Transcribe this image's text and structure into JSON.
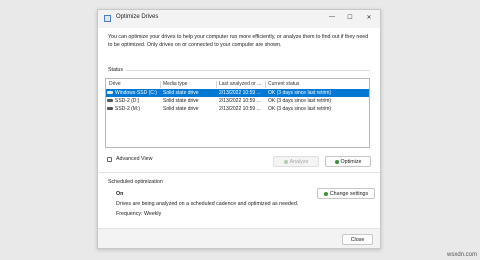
{
  "window": {
    "title": "Optimize Drives",
    "minimize_glyph": "—",
    "maximize_glyph": "☐",
    "close_glyph": "✕"
  },
  "intro": "You can optimize your drives to help your computer run more efficiently, or analyze them to find out if they need to be optimized. Only drives on or connected to your computer are shown.",
  "status": {
    "label": "Status",
    "columns": [
      "Drive",
      "Media type",
      "Last analyzed or ...",
      "Current status"
    ],
    "drives": [
      {
        "drive": "Windows-SSD (C:)",
        "media": "Solid state drive",
        "last": "2/13/2022 10:59 ...",
        "status": "OK (3 days since last retrim)",
        "selected": true
      },
      {
        "drive": "SSD-2 (D:)",
        "media": "Solid state drive",
        "last": "2/13/2022 10:59 ...",
        "status": "OK (3 days since last retrim)",
        "selected": false
      },
      {
        "drive": "SSD-2 (M:)",
        "media": "Solid state drive",
        "last": "2/13/2022 10:59 ...",
        "status": "OK (3 days since last retrim)",
        "selected": false
      }
    ]
  },
  "advanced_view": {
    "label": "Advanced View",
    "checked": false
  },
  "buttons": {
    "analyze": "Analyze",
    "optimize": "Optimize",
    "change_settings": "Change settings",
    "close": "Close"
  },
  "scheduled": {
    "label": "Scheduled optimization",
    "state": "On",
    "description": "Drives are being analyzed on a scheduled cadence and optimized as needed.",
    "frequency": "Frequency: Weekly"
  },
  "watermark": "wsxdn.com",
  "colors": {
    "selection": "#0078d4",
    "accent_icon": "#3a8f3a"
  }
}
